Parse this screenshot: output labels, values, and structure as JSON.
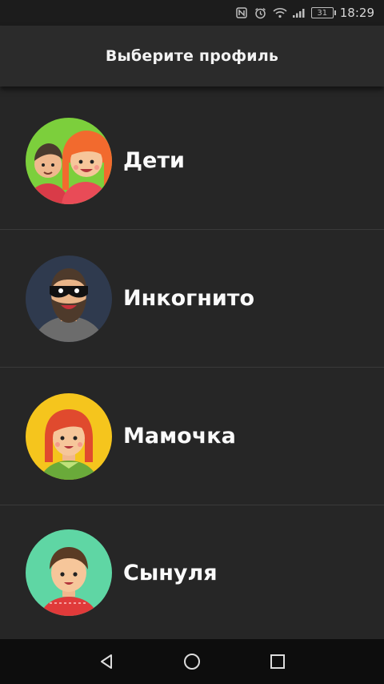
{
  "status_bar": {
    "icons": [
      "nfc-icon",
      "alarm-icon",
      "wifi-icon",
      "signal-icon"
    ],
    "battery_level": "31",
    "time": "18:29"
  },
  "app_bar": {
    "title": "Выберите профиль"
  },
  "profiles": [
    {
      "name": "Дети",
      "avatar": "kids-avatar",
      "avatar_bg": "#7ccf3c"
    },
    {
      "name": "Инкогнито",
      "avatar": "incognito-avatar",
      "avatar_bg": "#2f3a4e"
    },
    {
      "name": "Мамочка",
      "avatar": "mom-avatar",
      "avatar_bg": "#f5c51d"
    },
    {
      "name": "Сынуля",
      "avatar": "son-avatar",
      "avatar_bg": "#5fd6a4"
    }
  ],
  "nav_bar": {
    "buttons": [
      "back-icon",
      "home-icon",
      "recents-icon"
    ]
  }
}
